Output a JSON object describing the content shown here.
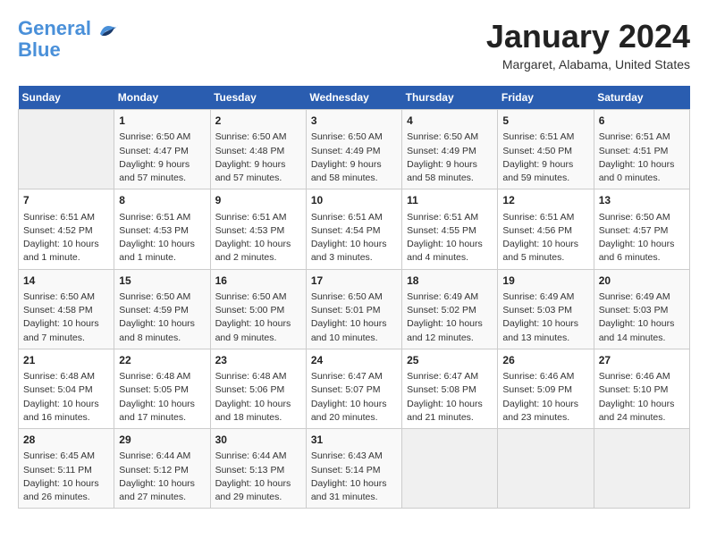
{
  "header": {
    "logo_line1": "General",
    "logo_line2": "Blue",
    "month": "January 2024",
    "location": "Margaret, Alabama, United States"
  },
  "days_of_week": [
    "Sunday",
    "Monday",
    "Tuesday",
    "Wednesday",
    "Thursday",
    "Friday",
    "Saturday"
  ],
  "weeks": [
    [
      {
        "day": "",
        "info": ""
      },
      {
        "day": "1",
        "info": "Sunrise: 6:50 AM\nSunset: 4:47 PM\nDaylight: 9 hours\nand 57 minutes."
      },
      {
        "day": "2",
        "info": "Sunrise: 6:50 AM\nSunset: 4:48 PM\nDaylight: 9 hours\nand 57 minutes."
      },
      {
        "day": "3",
        "info": "Sunrise: 6:50 AM\nSunset: 4:49 PM\nDaylight: 9 hours\nand 58 minutes."
      },
      {
        "day": "4",
        "info": "Sunrise: 6:50 AM\nSunset: 4:49 PM\nDaylight: 9 hours\nand 58 minutes."
      },
      {
        "day": "5",
        "info": "Sunrise: 6:51 AM\nSunset: 4:50 PM\nDaylight: 9 hours\nand 59 minutes."
      },
      {
        "day": "6",
        "info": "Sunrise: 6:51 AM\nSunset: 4:51 PM\nDaylight: 10 hours\nand 0 minutes."
      }
    ],
    [
      {
        "day": "7",
        "info": "Sunrise: 6:51 AM\nSunset: 4:52 PM\nDaylight: 10 hours\nand 1 minute."
      },
      {
        "day": "8",
        "info": "Sunrise: 6:51 AM\nSunset: 4:53 PM\nDaylight: 10 hours\nand 1 minute."
      },
      {
        "day": "9",
        "info": "Sunrise: 6:51 AM\nSunset: 4:53 PM\nDaylight: 10 hours\nand 2 minutes."
      },
      {
        "day": "10",
        "info": "Sunrise: 6:51 AM\nSunset: 4:54 PM\nDaylight: 10 hours\nand 3 minutes."
      },
      {
        "day": "11",
        "info": "Sunrise: 6:51 AM\nSunset: 4:55 PM\nDaylight: 10 hours\nand 4 minutes."
      },
      {
        "day": "12",
        "info": "Sunrise: 6:51 AM\nSunset: 4:56 PM\nDaylight: 10 hours\nand 5 minutes."
      },
      {
        "day": "13",
        "info": "Sunrise: 6:50 AM\nSunset: 4:57 PM\nDaylight: 10 hours\nand 6 minutes."
      }
    ],
    [
      {
        "day": "14",
        "info": "Sunrise: 6:50 AM\nSunset: 4:58 PM\nDaylight: 10 hours\nand 7 minutes."
      },
      {
        "day": "15",
        "info": "Sunrise: 6:50 AM\nSunset: 4:59 PM\nDaylight: 10 hours\nand 8 minutes."
      },
      {
        "day": "16",
        "info": "Sunrise: 6:50 AM\nSunset: 5:00 PM\nDaylight: 10 hours\nand 9 minutes."
      },
      {
        "day": "17",
        "info": "Sunrise: 6:50 AM\nSunset: 5:01 PM\nDaylight: 10 hours\nand 10 minutes."
      },
      {
        "day": "18",
        "info": "Sunrise: 6:49 AM\nSunset: 5:02 PM\nDaylight: 10 hours\nand 12 minutes."
      },
      {
        "day": "19",
        "info": "Sunrise: 6:49 AM\nSunset: 5:03 PM\nDaylight: 10 hours\nand 13 minutes."
      },
      {
        "day": "20",
        "info": "Sunrise: 6:49 AM\nSunset: 5:03 PM\nDaylight: 10 hours\nand 14 minutes."
      }
    ],
    [
      {
        "day": "21",
        "info": "Sunrise: 6:48 AM\nSunset: 5:04 PM\nDaylight: 10 hours\nand 16 minutes."
      },
      {
        "day": "22",
        "info": "Sunrise: 6:48 AM\nSunset: 5:05 PM\nDaylight: 10 hours\nand 17 minutes."
      },
      {
        "day": "23",
        "info": "Sunrise: 6:48 AM\nSunset: 5:06 PM\nDaylight: 10 hours\nand 18 minutes."
      },
      {
        "day": "24",
        "info": "Sunrise: 6:47 AM\nSunset: 5:07 PM\nDaylight: 10 hours\nand 20 minutes."
      },
      {
        "day": "25",
        "info": "Sunrise: 6:47 AM\nSunset: 5:08 PM\nDaylight: 10 hours\nand 21 minutes."
      },
      {
        "day": "26",
        "info": "Sunrise: 6:46 AM\nSunset: 5:09 PM\nDaylight: 10 hours\nand 23 minutes."
      },
      {
        "day": "27",
        "info": "Sunrise: 6:46 AM\nSunset: 5:10 PM\nDaylight: 10 hours\nand 24 minutes."
      }
    ],
    [
      {
        "day": "28",
        "info": "Sunrise: 6:45 AM\nSunset: 5:11 PM\nDaylight: 10 hours\nand 26 minutes."
      },
      {
        "day": "29",
        "info": "Sunrise: 6:44 AM\nSunset: 5:12 PM\nDaylight: 10 hours\nand 27 minutes."
      },
      {
        "day": "30",
        "info": "Sunrise: 6:44 AM\nSunset: 5:13 PM\nDaylight: 10 hours\nand 29 minutes."
      },
      {
        "day": "31",
        "info": "Sunrise: 6:43 AM\nSunset: 5:14 PM\nDaylight: 10 hours\nand 31 minutes."
      },
      {
        "day": "",
        "info": ""
      },
      {
        "day": "",
        "info": ""
      },
      {
        "day": "",
        "info": ""
      }
    ]
  ]
}
